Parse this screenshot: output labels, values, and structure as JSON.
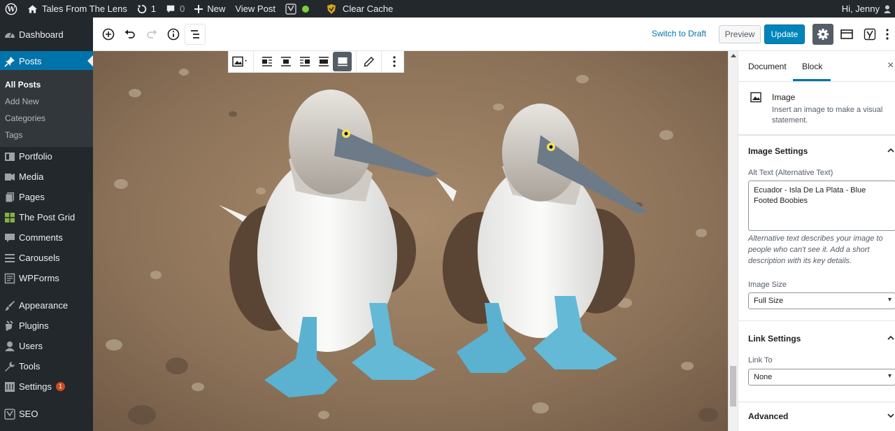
{
  "adminbar": {
    "site_name": "Tales From The Lens",
    "updates_count": "1",
    "comments_count": "0",
    "new_label": "New",
    "view_post_label": "View Post",
    "clear_cache_label": "Clear Cache",
    "greeting": "Hi, Jenny"
  },
  "sidebar": {
    "dashboard": "Dashboard",
    "posts": "Posts",
    "posts_sub": {
      "all_posts": "All Posts",
      "add_new": "Add New",
      "categories": "Categories",
      "tags": "Tags"
    },
    "portfolio": "Portfolio",
    "media": "Media",
    "pages": "Pages",
    "post_grid": "The Post Grid",
    "comments": "Comments",
    "carousels": "Carousels",
    "wpforms": "WPForms",
    "appearance": "Appearance",
    "plugins": "Plugins",
    "users": "Users",
    "tools": "Tools",
    "settings": "Settings",
    "settings_badge": "1",
    "seo": "SEO"
  },
  "header": {
    "switch_to_draft": "Switch to Draft",
    "preview": "Preview",
    "update": "Update"
  },
  "panel": {
    "tabs": {
      "document": "Document",
      "block": "Block"
    },
    "close": "×",
    "block_card": {
      "title": "Image",
      "description": "Insert an image to make a visual statement."
    },
    "image_settings": {
      "title": "Image Settings",
      "alt_label": "Alt Text (Alternative Text)",
      "alt_value": "Ecuador - Isla De La Plata - Blue Footed Boobies",
      "alt_help": "Alternative text describes your image to people who can't see it. Add a short description with its key details.",
      "size_label": "Image Size",
      "size_value": "Full Size"
    },
    "link_settings": {
      "title": "Link Settings",
      "link_to_label": "Link To",
      "link_to_value": "None"
    },
    "advanced": {
      "title": "Advanced"
    }
  },
  "colors": {
    "admin_dark": "#23282d",
    "accent_blue": "#0073aa",
    "update_blue": "#0085ba",
    "badge_red": "#ca4a1f"
  }
}
